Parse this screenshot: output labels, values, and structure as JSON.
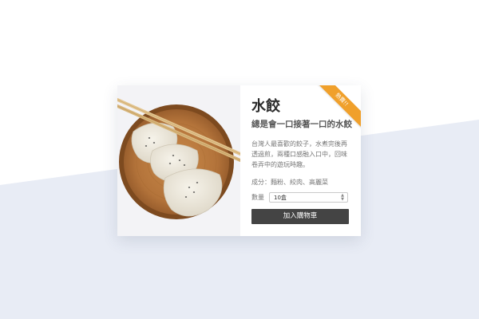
{
  "product": {
    "title": "水餃",
    "subtitle": "總是會一口接著一口的水餃",
    "description": "台灣人最喜歡的餃子，水煮完後再透過煎，兩種口感融入口中，回味卷弄中的遊玩時趣。",
    "ingredients": "成分：麵粉、絞肉、高麗菜",
    "quantity_label": "數量",
    "quantity_value": "10盒",
    "add_to_cart_label": "加入購物車",
    "ribbon_label": "熱賣!!",
    "image_icon": "dumpling-plate-photo"
  },
  "colors": {
    "ribbon": "#f0a02b",
    "button": "#444444",
    "background_band": "#e8ecf5"
  }
}
